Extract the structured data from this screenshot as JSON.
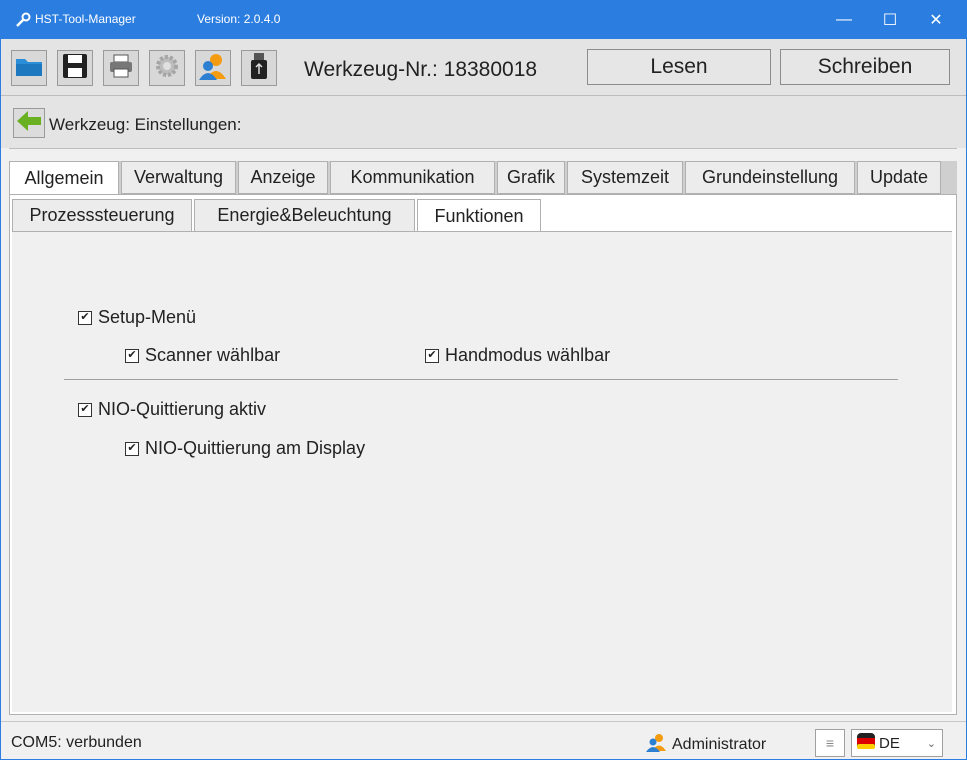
{
  "window": {
    "title": "HST-Tool-Manager",
    "version": "Version: 2.0.4.0",
    "minimize": "—",
    "maximize": "☐",
    "close": "✕"
  },
  "toolbar": {
    "tool_number_label": "Werkzeug-Nr.: 18380018",
    "read_label": "Lesen",
    "write_label": "Schreiben",
    "icons": [
      "folder-open-icon",
      "save-icon",
      "print-icon",
      "settings-gear-icon",
      "users-icon",
      "usb-icon"
    ]
  },
  "breadcrumb": {
    "label": "Werkzeug: Einstellungen:"
  },
  "tabs": [
    "Allgemein",
    "Verwaltung",
    "Anzeige",
    "Kommunikation",
    "Grafik",
    "Systemzeit",
    "Grundeinstellung",
    "Update"
  ],
  "subtabs": [
    "Prozesssteuerung",
    "Energie&Beleuchtung",
    "Funktionen"
  ],
  "options": {
    "setup_menu": {
      "label": "Setup-Menü",
      "checked": true
    },
    "scanner_selectable": {
      "label": "Scanner wählbar",
      "checked": true
    },
    "hand_mode_selectable": {
      "label": "Handmodus wählbar",
      "checked": true
    },
    "nio_ack_active": {
      "label": "NIO-Quittierung aktiv",
      "checked": true
    },
    "nio_ack_display": {
      "label": "NIO-Quittierung am Display",
      "checked": true
    }
  },
  "status": {
    "connection": "COM5: verbunden",
    "user": "Administrator",
    "language": "DE"
  },
  "colors": {
    "titlebar": "#2b7de0",
    "back_arrow": "#6ab023"
  }
}
